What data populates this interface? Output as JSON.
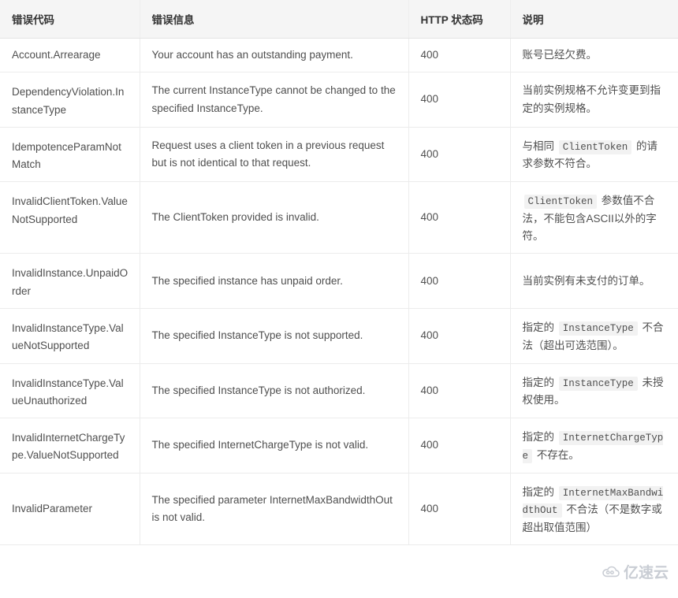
{
  "table": {
    "headers": [
      "错误代码",
      "错误信息",
      "HTTP 状态码",
      "说明"
    ],
    "rows": [
      {
        "code": "Account.Arrearage",
        "message": "Your account has an outstanding payment.",
        "http": "400",
        "desc_parts": [
          {
            "t": "text",
            "v": "账号已经欠费。"
          }
        ]
      },
      {
        "code": "DependencyViolation.InstanceType",
        "message": "The current InstanceType cannot be changed to the specified InstanceType.",
        "http": "400",
        "desc_parts": [
          {
            "t": "text",
            "v": "当前实例规格不允许变更到指定的实例规格。"
          }
        ]
      },
      {
        "code": "IdempotenceParamNotMatch",
        "message": "Request uses a client token in a previous request but is not identical to that request.",
        "http": "400",
        "desc_parts": [
          {
            "t": "text",
            "v": "与相同 "
          },
          {
            "t": "code",
            "v": "ClientToken"
          },
          {
            "t": "text",
            "v": " 的请求参数不符合。"
          }
        ]
      },
      {
        "code": "InvalidClientToken.ValueNotSupported",
        "message": "The ClientToken provided is invalid.",
        "http": "400",
        "desc_parts": [
          {
            "t": "code",
            "v": "ClientToken"
          },
          {
            "t": "text",
            "v": " 参数值不合法，不能包含ASCII以外的字符。"
          }
        ]
      },
      {
        "code": "InvalidInstance.UnpaidOrder",
        "message": "The specified instance has unpaid order.",
        "http": "400",
        "desc_parts": [
          {
            "t": "text",
            "v": "当前实例有未支付的订单。"
          }
        ]
      },
      {
        "code": "InvalidInstanceType.ValueNotSupported",
        "message": "The specified InstanceType is not supported.",
        "http": "400",
        "desc_parts": [
          {
            "t": "text",
            "v": "指定的 "
          },
          {
            "t": "code",
            "v": "InstanceType"
          },
          {
            "t": "text",
            "v": " 不合法（超出可选范围）。"
          }
        ]
      },
      {
        "code": "InvalidInstanceType.ValueUnauthorized",
        "message": "The specified InstanceType is not authorized.",
        "http": "400",
        "desc_parts": [
          {
            "t": "text",
            "v": "指定的 "
          },
          {
            "t": "code",
            "v": "InstanceType"
          },
          {
            "t": "text",
            "v": " 未授权使用。"
          }
        ]
      },
      {
        "code": "InvalidInternetChargeType.ValueNotSupported",
        "message": "The specified InternetChargeType is not valid.",
        "http": "400",
        "desc_parts": [
          {
            "t": "text",
            "v": "指定的 "
          },
          {
            "t": "code",
            "v": "InternetChargeType"
          },
          {
            "t": "text",
            "v": " 不存在。"
          }
        ]
      },
      {
        "code": "InvalidParameter",
        "message": "The specified parameter InternetMaxBandwidthOut is not valid.",
        "http": "400",
        "desc_parts": [
          {
            "t": "text",
            "v": "指定的 "
          },
          {
            "t": "code",
            "v": "InternetMaxBandwidthOut"
          },
          {
            "t": "text",
            "v": " 不合法（不是数字或超出取值范围）"
          }
        ]
      }
    ]
  },
  "watermark": {
    "label": "亿速云",
    "icon": "cloud-icon",
    "color": "#c9cdd4"
  }
}
